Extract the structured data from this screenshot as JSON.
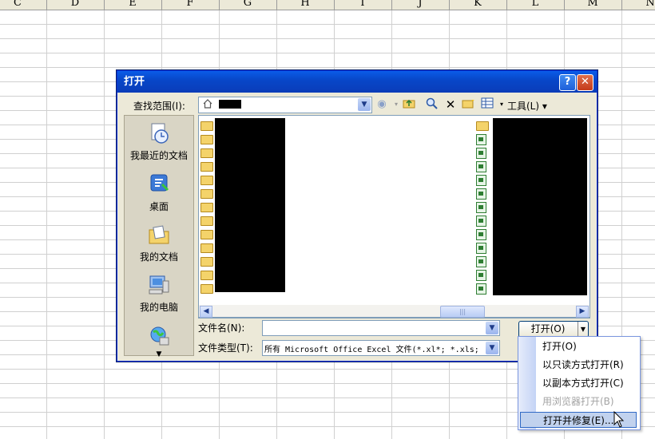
{
  "spreadsheet": {
    "columns": [
      "C",
      "D",
      "E",
      "F",
      "G",
      "H",
      "I",
      "J",
      "K",
      "L",
      "M",
      "N"
    ]
  },
  "dialog": {
    "title": "打开",
    "help_label": "?",
    "close_label": "✕",
    "look_in_label": "查找范围(I):",
    "tools_label": "工具(L)",
    "places": [
      {
        "label": "我最近的文档",
        "icon": "recent-documents-icon"
      },
      {
        "label": "桌面",
        "icon": "desktop-icon"
      },
      {
        "label": "我的文档",
        "icon": "my-documents-icon"
      },
      {
        "label": "我的电脑",
        "icon": "my-computer-icon"
      },
      {
        "label": "",
        "icon": "network-places-icon"
      }
    ],
    "file_name_label": "文件名(N):",
    "file_name_value": "",
    "file_type_label": "文件类型(T):",
    "file_type_value": "所有 Microsoft Office Excel 文件(*.xl*; *.xls;",
    "open_button": "打开(O)",
    "scroll_thumb": "|||"
  },
  "open_menu": {
    "items": [
      {
        "label": "打开(O)",
        "enabled": true
      },
      {
        "label": "以只读方式打开(R)",
        "enabled": true
      },
      {
        "label": "以副本方式打开(C)",
        "enabled": true
      },
      {
        "label": "用浏览器打开(B)",
        "enabled": false
      },
      {
        "label": "打开并修复(E)...",
        "enabled": true,
        "highlighted": true
      }
    ]
  },
  "colors": {
    "titlebar": "#0a4fd4",
    "dialog_bg": "#ece9d8",
    "selection": "#316ac5"
  }
}
